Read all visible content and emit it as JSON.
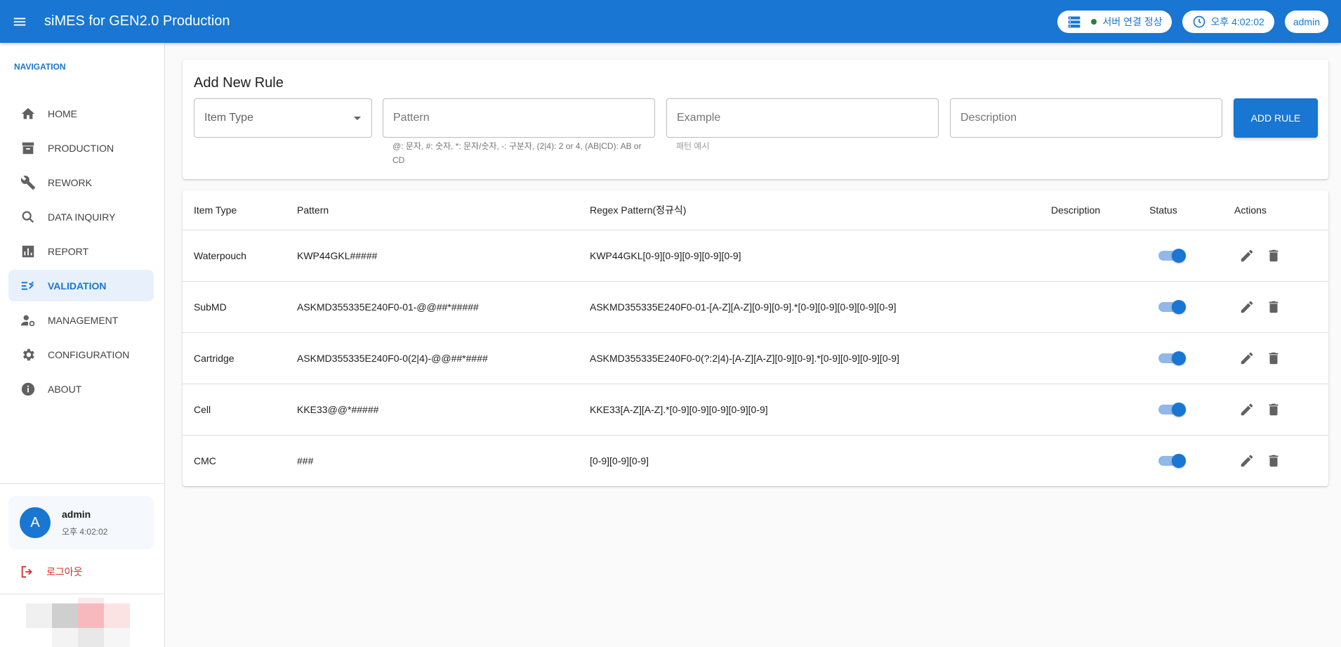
{
  "appbar": {
    "title": "siMES for GEN2.0 Production",
    "server_status": "서버 연결 정상",
    "clock": "오후 4:02:02",
    "user": "admin"
  },
  "sidebar": {
    "heading": "NAVIGATION",
    "items": [
      {
        "label": "HOME",
        "icon": "home-icon",
        "active": false
      },
      {
        "label": "PRODUCTION",
        "icon": "archive-icon",
        "active": false
      },
      {
        "label": "REWORK",
        "icon": "wrench-icon",
        "active": false
      },
      {
        "label": "DATA INQUIRY",
        "icon": "search-icon",
        "active": false
      },
      {
        "label": "REPORT",
        "icon": "chart-icon",
        "active": false
      },
      {
        "label": "VALIDATION",
        "icon": "checklist-icon",
        "active": true
      },
      {
        "label": "MANAGEMENT",
        "icon": "user-settings-icon",
        "active": false
      },
      {
        "label": "CONFIGURATION",
        "icon": "gear-icon",
        "active": false
      },
      {
        "label": "ABOUT",
        "icon": "info-icon",
        "active": false
      }
    ],
    "user_card": {
      "avatar_letter": "A",
      "name": "admin",
      "time": "오후 4:02:02"
    },
    "logout_label": "로그아웃"
  },
  "form": {
    "title": "Add New Rule",
    "item_type_placeholder": "Item Type",
    "pattern_placeholder": "Pattern",
    "pattern_helper": "@: 문자, #: 숫자, *: 문자/숫자, -: 구분자, (2|4): 2 or 4, (AB|CD): AB or CD",
    "example_placeholder": "Example",
    "example_helper": "패턴 예시",
    "description_placeholder": "Description",
    "add_button": "ADD RULE"
  },
  "table": {
    "headers": {
      "item_type": "Item Type",
      "pattern": "Pattern",
      "regex": "Regex Pattern(정규식)",
      "description": "Description",
      "status": "Status",
      "actions": "Actions"
    },
    "rows": [
      {
        "item_type": "Waterpouch",
        "pattern": "KWP44GKL#####",
        "regex": "KWP44GKL[0-9][0-9][0-9][0-9][0-9]",
        "description": "",
        "enabled": true
      },
      {
        "item_type": "SubMD",
        "pattern": "ASKMD355335E240F0-01-@@##*#####",
        "regex": "ASKMD355335E240F0-01-[A-Z][A-Z][0-9][0-9].*[0-9][0-9][0-9][0-9][0-9]",
        "description": "",
        "enabled": true
      },
      {
        "item_type": "Cartridge",
        "pattern": "ASKMD355335E240F0-0(2|4)-@@##*####",
        "regex": "ASKMD355335E240F0-0(?:2|4)-[A-Z][A-Z][0-9][0-9].*[0-9][0-9][0-9][0-9]",
        "description": "",
        "enabled": true
      },
      {
        "item_type": "Cell",
        "pattern": "KKE33@@*#####",
        "regex": "KKE33[A-Z][A-Z].*[0-9][0-9][0-9][0-9][0-9]",
        "description": "",
        "enabled": true
      },
      {
        "item_type": "CMC",
        "pattern": "###",
        "regex": "[0-9][0-9][0-9]",
        "description": "",
        "enabled": true
      }
    ]
  },
  "colors": {
    "primary": "#1976d2",
    "danger": "#d32f2f",
    "status_ok": "#2e7d32"
  }
}
